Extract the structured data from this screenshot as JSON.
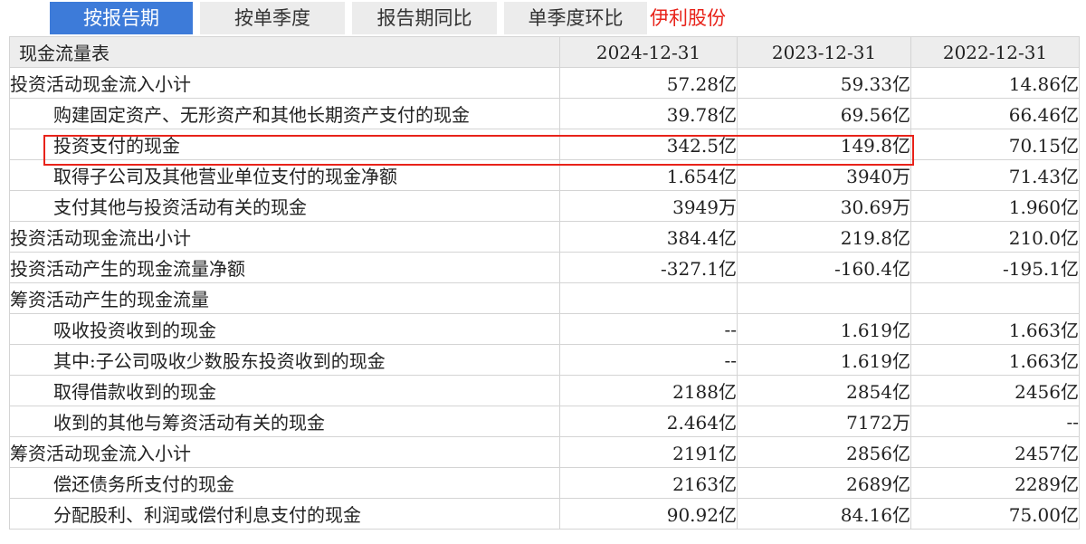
{
  "tabs": [
    {
      "label": "按报告期",
      "active": true
    },
    {
      "label": "按单季度",
      "active": false
    },
    {
      "label": "报告期同比",
      "active": false
    },
    {
      "label": "单季度环比",
      "active": false
    }
  ],
  "company_name": "伊利股份",
  "table": {
    "title": "现金流量表",
    "columns": [
      "2024-12-31",
      "2023-12-31",
      "2022-12-31"
    ],
    "rows": [
      {
        "label": "投资活动现金流入小计",
        "indent": false,
        "values": [
          "57.28亿",
          "59.33亿",
          "14.86亿"
        ]
      },
      {
        "label": "购建固定资产、无形资产和其他长期资产支付的现金",
        "indent": true,
        "values": [
          "39.78亿",
          "69.56亿",
          "66.46亿"
        ]
      },
      {
        "label": "投资支付的现金",
        "indent": true,
        "values": [
          "342.5亿",
          "149.8亿",
          "70.15亿"
        ]
      },
      {
        "label": "取得子公司及其他营业单位支付的现金净额",
        "indent": true,
        "values": [
          "1.654亿",
          "3940万",
          "71.43亿"
        ]
      },
      {
        "label": "支付其他与投资活动有关的现金",
        "indent": true,
        "values": [
          "3949万",
          "30.69万",
          "1.960亿"
        ]
      },
      {
        "label": "投资活动现金流出小计",
        "indent": false,
        "values": [
          "384.4亿",
          "219.8亿",
          "210.0亿"
        ]
      },
      {
        "label": "投资活动产生的现金流量净额",
        "indent": false,
        "values": [
          "-327.1亿",
          "-160.4亿",
          "-195.1亿"
        ]
      },
      {
        "label": "筹资活动产生的现金流量",
        "indent": false,
        "values": [
          "",
          "",
          ""
        ]
      },
      {
        "label": "吸收投资收到的现金",
        "indent": true,
        "values": [
          "--",
          "1.619亿",
          "1.663亿"
        ]
      },
      {
        "label": "其中:子公司吸收少数股东投资收到的现金",
        "indent": true,
        "values": [
          "--",
          "1.619亿",
          "1.663亿"
        ]
      },
      {
        "label": "取得借款收到的现金",
        "indent": true,
        "values": [
          "2188亿",
          "2854亿",
          "2456亿"
        ]
      },
      {
        "label": "收到的其他与筹资活动有关的现金",
        "indent": true,
        "values": [
          "2.464亿",
          "7172万",
          "--"
        ]
      },
      {
        "label": "筹资活动现金流入小计",
        "indent": false,
        "values": [
          "2191亿",
          "2856亿",
          "2457亿"
        ]
      },
      {
        "label": "偿还债务所支付的现金",
        "indent": true,
        "values": [
          "2163亿",
          "2689亿",
          "2289亿"
        ]
      },
      {
        "label": "分配股利、利润或偿付利息支付的现金",
        "indent": true,
        "values": [
          "90.92亿",
          "84.16亿",
          "75.00亿"
        ]
      }
    ]
  },
  "colors": {
    "tab_active": "#3d7bd9",
    "tab_inactive": "#ececec",
    "highlight": "#e8231a",
    "company": "#e8231a"
  }
}
